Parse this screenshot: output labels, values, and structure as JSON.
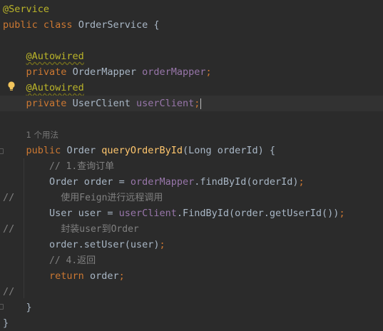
{
  "editor": {
    "lines": {
      "l1": {
        "annotation": "@Service"
      },
      "l2": {
        "kw1": "public",
        "kw2": "class",
        "name": "OrderService",
        "brace": " {"
      },
      "l4": {
        "annotation": "@Autowired"
      },
      "l5": {
        "kw": "private",
        "type": "OrderMapper",
        "field": "orderMapper",
        "semi": ";"
      },
      "l6": {
        "annotation": "@Autowired"
      },
      "l7": {
        "kw": "private",
        "type": "UserClient",
        "field": "userClient",
        "semi": ";"
      },
      "l9": {
        "usage_hint": "1 个用法"
      },
      "l10": {
        "kw": "public",
        "type": "Order",
        "method": "queryOrderById",
        "params": "(Long orderId) {"
      },
      "l11": {
        "comment": "// 1.查询订单"
      },
      "l12": {
        "type": "Order",
        "var": " order = ",
        "field": "orderMapper",
        "call": ".findById(orderId)",
        "semi": ";"
      },
      "l13": {
        "prefix": "//",
        "comment": "使用Feign进行远程调用"
      },
      "l14": {
        "type": "User",
        "var": " user = ",
        "field": "userClient",
        "call": ".FindById(order.getUserId())",
        "semi": ";"
      },
      "l15": {
        "prefix": "//",
        "comment": "封装user到Order"
      },
      "l16": {
        "call": "order.setUser(user)",
        "semi": ";"
      },
      "l17": {
        "comment": "// 4.返回"
      },
      "l18": {
        "kw": "return",
        "var": " order",
        "semi": ";"
      },
      "l19": {
        "prefix": "//"
      },
      "l20": {
        "brace": "}"
      },
      "l21": {
        "brace": "}"
      }
    },
    "icons": {
      "intention": "lightbulb-icon"
    },
    "colors": {
      "background": "#2b2b2b",
      "keyword": "#cc7832",
      "annotation": "#bbb529",
      "field": "#9876aa",
      "method": "#ffc66d",
      "comment": "#808080",
      "text": "#a9b7c6",
      "current_line": "#323232"
    }
  }
}
